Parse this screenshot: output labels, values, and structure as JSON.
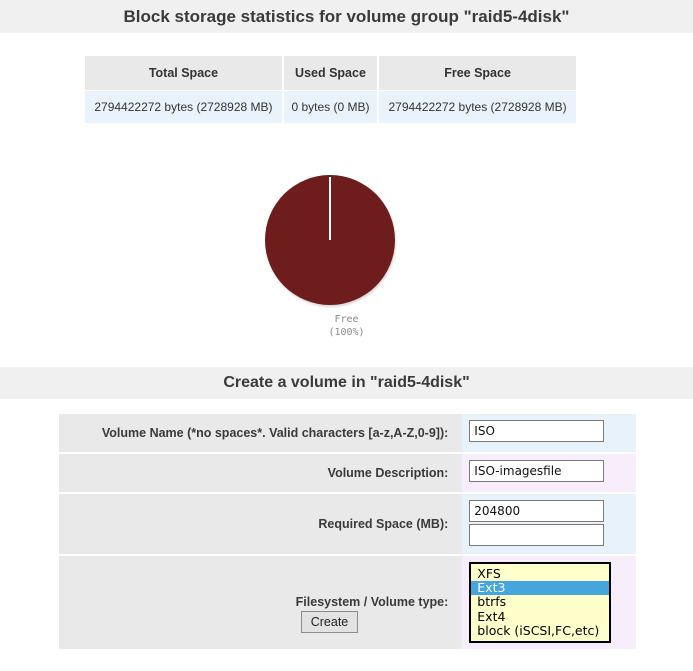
{
  "page": {
    "storage_heading": "Block storage statistics for volume group \"raid5-4disk\"",
    "form_heading": "Create a volume in \"raid5-4disk\""
  },
  "stats_table": {
    "columns": [
      "Total Space",
      "Used Space",
      "Free Space"
    ],
    "row": [
      "2794422272 bytes (2728928 MB)",
      "0 bytes (0 MB)",
      "2794422272 bytes (2728928 MB)"
    ]
  },
  "chart_data": {
    "type": "pie",
    "title": "",
    "labels": [
      "Free"
    ],
    "values": [
      100
    ],
    "value_unit": "percent",
    "colors": [
      "#6e1c1c"
    ],
    "legend_position": "bottom",
    "annotations": [
      "Free",
      "(100%)"
    ],
    "caption_line1": "Free",
    "caption_line2": "(100%)",
    "total_bytes": 2794422272,
    "used_bytes": 0,
    "free_bytes": 2794422272
  },
  "form": {
    "rows": [
      {
        "label": "Volume Name (*no spaces*. Valid characters [a-z,A-Z,0-9]):",
        "value": "ISO",
        "placeholder": ""
      },
      {
        "label": "Volume Description:",
        "value": "ISO-imagesfile",
        "placeholder": ""
      },
      {
        "label": "Required Space (MB):",
        "value": "204800",
        "value2": "",
        "placeholder": ""
      },
      {
        "label": "Filesystem / Volume type:"
      }
    ],
    "filesystem_options": [
      "XFS",
      "Ext3",
      "btrfs",
      "Ext4",
      "block (iSCSI,FC,etc)"
    ],
    "filesystem_selected": "Ext3",
    "submit_label": "Create"
  },
  "colors": {
    "banner_bg": "#f0f0f0",
    "pie_free": "#6e1c1c",
    "row_label_bg": "#e9e9e9",
    "field_blue": "#e7f2fb",
    "field_pink": "#f8eefb",
    "listbox_bg": "#ffffcc",
    "listbox_highlight": "#44a6dd",
    "table_data_bg": "#eaf3fb"
  }
}
